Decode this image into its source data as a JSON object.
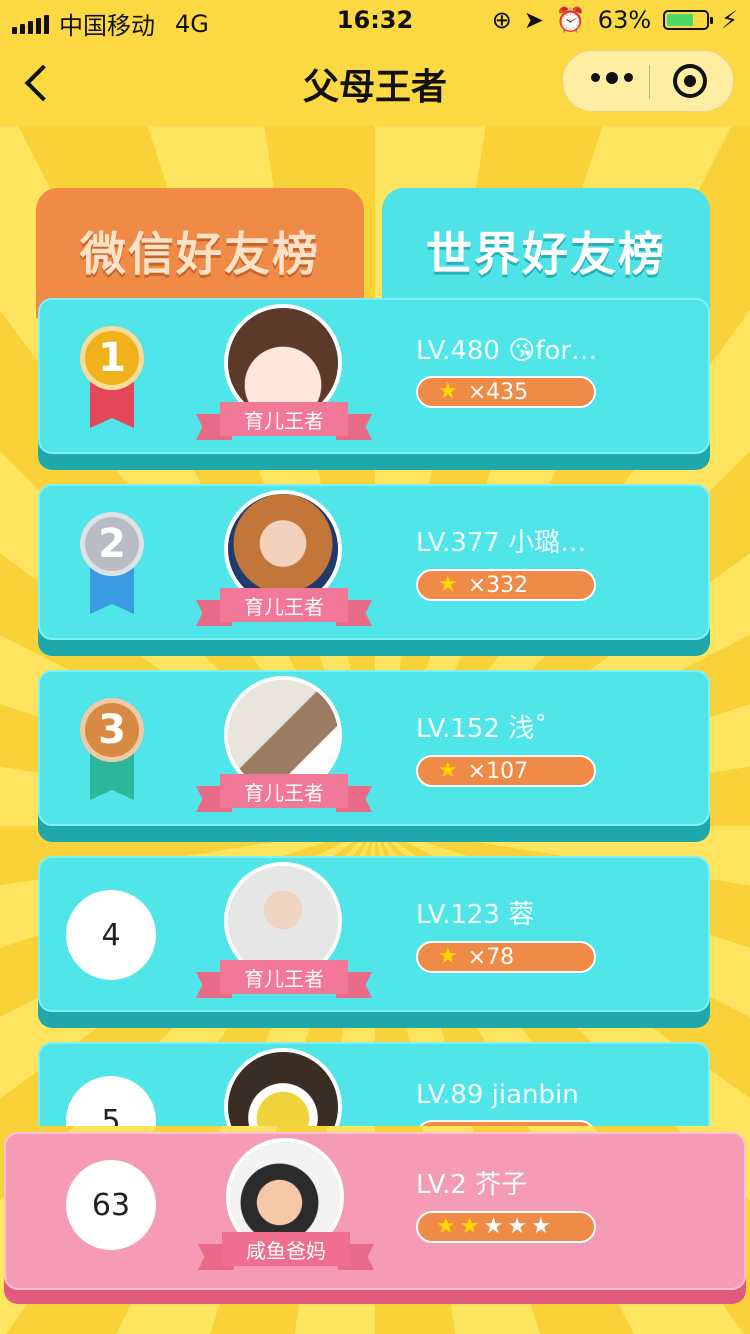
{
  "status_bar": {
    "carrier": "中国移动",
    "network": "4G",
    "time": "16:32",
    "battery": "63%",
    "battery_level": 0.63
  },
  "nav": {
    "title": "父母王者"
  },
  "tabs": [
    {
      "label": "微信好友榜",
      "active": false
    },
    {
      "label": "世界好友榜",
      "active": true
    }
  ],
  "leaderboard": [
    {
      "rank": "1",
      "level_name": "LV.480 😘for…",
      "title": "育儿王者",
      "stars": "×435",
      "medal": "gold"
    },
    {
      "rank": "2",
      "level_name": "LV.377 小璐…",
      "title": "育儿王者",
      "stars": "×332",
      "medal": "silver"
    },
    {
      "rank": "3",
      "level_name": "LV.152 浅˚",
      "title": "育儿王者",
      "stars": "×107",
      "medal": "bronze"
    },
    {
      "rank": "4",
      "level_name": "LV.123 蓉",
      "title": "育儿王者",
      "stars": "×78",
      "medal": null
    },
    {
      "rank": "5",
      "level_name": "LV.89 jianbin",
      "title": "",
      "stars": "",
      "medal": null
    }
  ],
  "my_rank": {
    "rank": "63",
    "level_name": "LV.2 芥子",
    "title": "咸鱼爸妈",
    "stars_filled": 2,
    "stars_total": 5
  },
  "colors": {
    "background": "#fcd943",
    "card": "#50e5e8",
    "tab_wechat": "#ef8a47",
    "my_rank_card": "#f69bb6",
    "star_pill": "#ef8a47",
    "gold": "#f1b11b",
    "silver": "#b9bcc4",
    "bronze": "#d98a42"
  }
}
